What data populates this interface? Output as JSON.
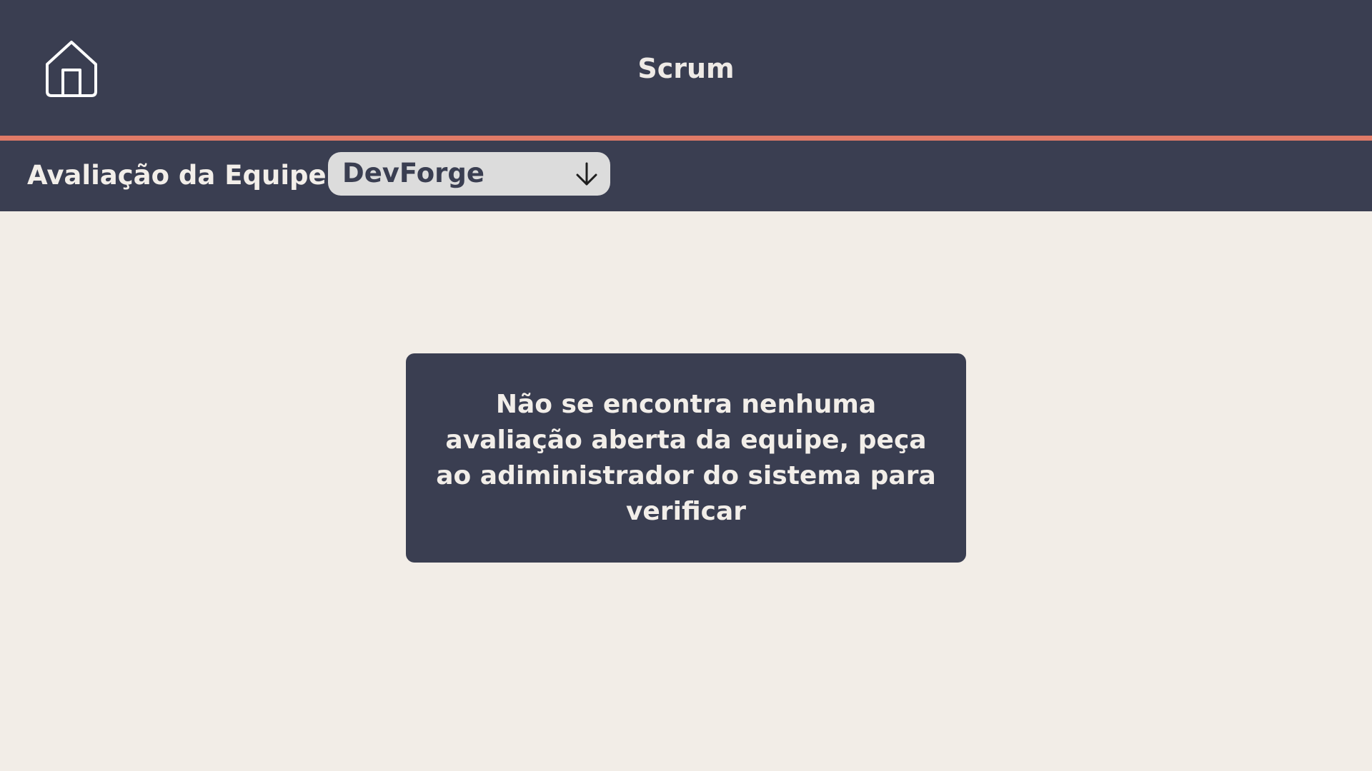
{
  "header": {
    "title": "Scrum",
    "home_icon": "home-icon"
  },
  "toolbar": {
    "label": "Avaliação da Equipe:",
    "team_select": {
      "value": "DevForge",
      "icon": "arrow-down-icon"
    }
  },
  "notice": {
    "message": "Não se encontra nenhuma avaliação aberta da equipe, peça ao adiministrador do sistema para verificar"
  },
  "colors": {
    "header_bg": "#3a3e51",
    "accent": "#e07a67",
    "page_bg": "#f2ede7",
    "select_bg": "#dcdcdc",
    "text_light": "#f2eee9"
  }
}
